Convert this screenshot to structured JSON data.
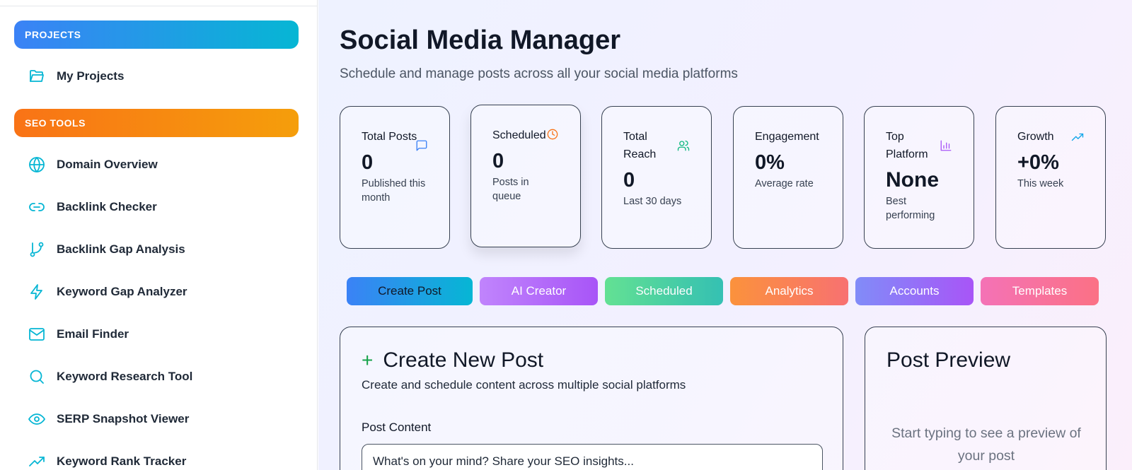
{
  "sidebar": {
    "projects_header": "PROJECTS",
    "seo_header": "SEO TOOLS",
    "projects": [
      {
        "label": "My Projects",
        "icon": "folder-open-icon"
      }
    ],
    "tools": [
      {
        "label": "Domain Overview",
        "icon": "globe-icon"
      },
      {
        "label": "Backlink Checker",
        "icon": "link-icon"
      },
      {
        "label": "Backlink Gap Analysis",
        "icon": "git-branch-icon"
      },
      {
        "label": "Keyword Gap Analyzer",
        "icon": "bolt-icon"
      },
      {
        "label": "Email Finder",
        "icon": "mail-icon"
      },
      {
        "label": "Keyword Research Tool",
        "icon": "search-icon"
      },
      {
        "label": "SERP Snapshot Viewer",
        "icon": "eye-icon"
      },
      {
        "label": "Keyword Rank Tracker",
        "icon": "trending-up-icon"
      }
    ]
  },
  "header": {
    "title": "Social Media Manager",
    "subtitle": "Schedule and manage posts across all your social media platforms"
  },
  "stats": [
    {
      "label": "Total Posts",
      "value": "0",
      "sub": "Published this month",
      "icon": "message-square-icon",
      "icon_color": "#3b82f6"
    },
    {
      "label": "Scheduled",
      "value": "0",
      "sub": "Posts in queue",
      "icon": "clock-icon",
      "icon_color": "#f97316"
    },
    {
      "label": "Total Reach",
      "value": "0",
      "sub": "Last 30 days",
      "icon": "users-icon",
      "icon_color": "#10b981"
    },
    {
      "label": "Engagement",
      "value": "0%",
      "sub": "Average rate"
    },
    {
      "label": "Top Platform",
      "value": "None",
      "sub": "Best performing",
      "icon": "bar-chart-icon",
      "icon_color": "#a855f7"
    },
    {
      "label": "Growth",
      "value": "+0%",
      "sub": "This week",
      "icon": "trending-up-icon",
      "icon_color": "#0ea5e9"
    }
  ],
  "tabs": [
    {
      "label": "Create Post",
      "active": true
    },
    {
      "label": "AI Creator"
    },
    {
      "label": "Scheduled"
    },
    {
      "label": "Analytics"
    },
    {
      "label": "Accounts"
    },
    {
      "label": "Templates"
    }
  ],
  "create_post": {
    "title": "Create New Post",
    "description": "Create and schedule content across multiple social platforms",
    "content_label": "Post Content",
    "content_placeholder": "What's on your mind? Share your SEO insights..."
  },
  "preview": {
    "title": "Post Preview",
    "empty_text": "Start typing to see a preview of your post"
  },
  "colors": {
    "projects_gradient": [
      "#3b82f6",
      "#06b6d4"
    ],
    "seo_gradient": [
      "#f97316",
      "#f59e0b"
    ],
    "icon_accent": "#06b6d4"
  }
}
